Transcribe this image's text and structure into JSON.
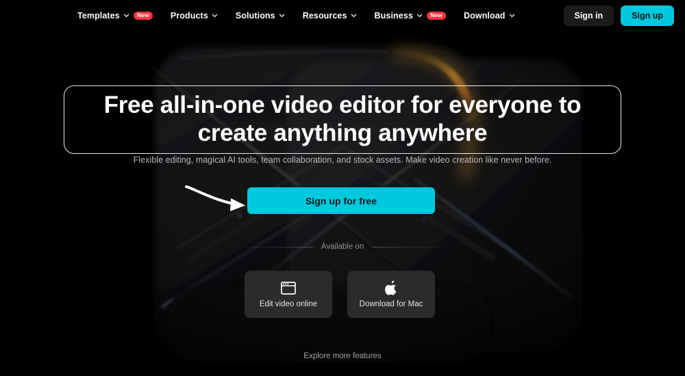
{
  "nav": {
    "items": [
      {
        "label": "Templates",
        "chevron": "chevron-down-icon",
        "badge": "New"
      },
      {
        "label": "Products",
        "chevron": "chevron-down-icon",
        "badge": null
      },
      {
        "label": "Solutions",
        "chevron": "chevron-down-icon",
        "badge": null
      },
      {
        "label": "Resources",
        "chevron": "chevron-down-icon",
        "badge": null
      },
      {
        "label": "Business",
        "chevron": "chevron-down-icon",
        "badge": "New"
      },
      {
        "label": "Download",
        "chevron": "chevron-down-icon",
        "badge": null
      }
    ],
    "sign_in_label": "Sign in",
    "sign_up_label": "Sign up"
  },
  "hero": {
    "headline": "Free all-in-one video editor for everyone to create anything anywhere",
    "subtitle": "Flexible editing, magical AI tools, team collaboration, and stock assets. Make video creation like never before.",
    "cta_label": "Sign up for free",
    "arrow_icon": "curved-arrow-icon",
    "available_label": "Available on",
    "platforms": [
      {
        "icon": "browser-window-icon",
        "label": "Edit video online"
      },
      {
        "icon": "apple-logo-icon",
        "label": "Download for Mac"
      }
    ],
    "explore_label": "Explore more features"
  },
  "colors": {
    "background": "#000000",
    "accent_cyan": "#00c8dd",
    "badge_red": "#f5333f",
    "card_surface": "#2b2b2d",
    "signin_surface": "#1b1b1d",
    "text_primary": "#ffffff",
    "text_muted": "#b9babc"
  }
}
